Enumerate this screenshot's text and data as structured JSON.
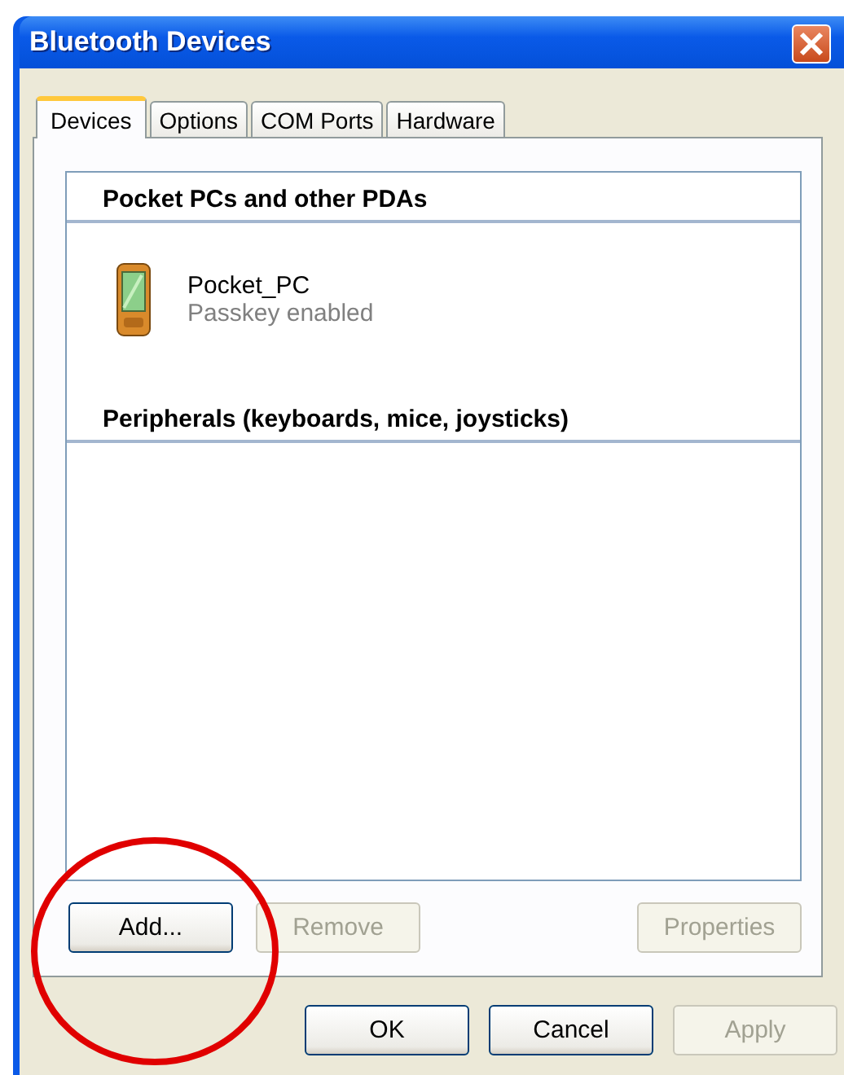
{
  "window": {
    "title": "Bluetooth Devices"
  },
  "tabs": [
    {
      "label": "Devices",
      "selected": true
    },
    {
      "label": "Options",
      "selected": false
    },
    {
      "label": "COM Ports",
      "selected": false
    },
    {
      "label": "Hardware",
      "selected": false
    }
  ],
  "groups": [
    {
      "title": "Pocket PCs and other PDAs",
      "devices": [
        {
          "name": "Pocket_PC",
          "status": "Passkey enabled"
        }
      ]
    },
    {
      "title": "Peripherals (keyboards, mice, joysticks)"
    }
  ],
  "panel_buttons": [
    {
      "label": "Add...",
      "disabled": false
    },
    {
      "label": "Remove",
      "disabled": true
    },
    {
      "label": "Properties",
      "disabled": true
    }
  ],
  "dialog_buttons": [
    {
      "label": "OK",
      "disabled": false
    },
    {
      "label": "Cancel",
      "disabled": false
    },
    {
      "label": "Apply",
      "disabled": true
    }
  ],
  "highlight": {
    "kind": "circle"
  }
}
